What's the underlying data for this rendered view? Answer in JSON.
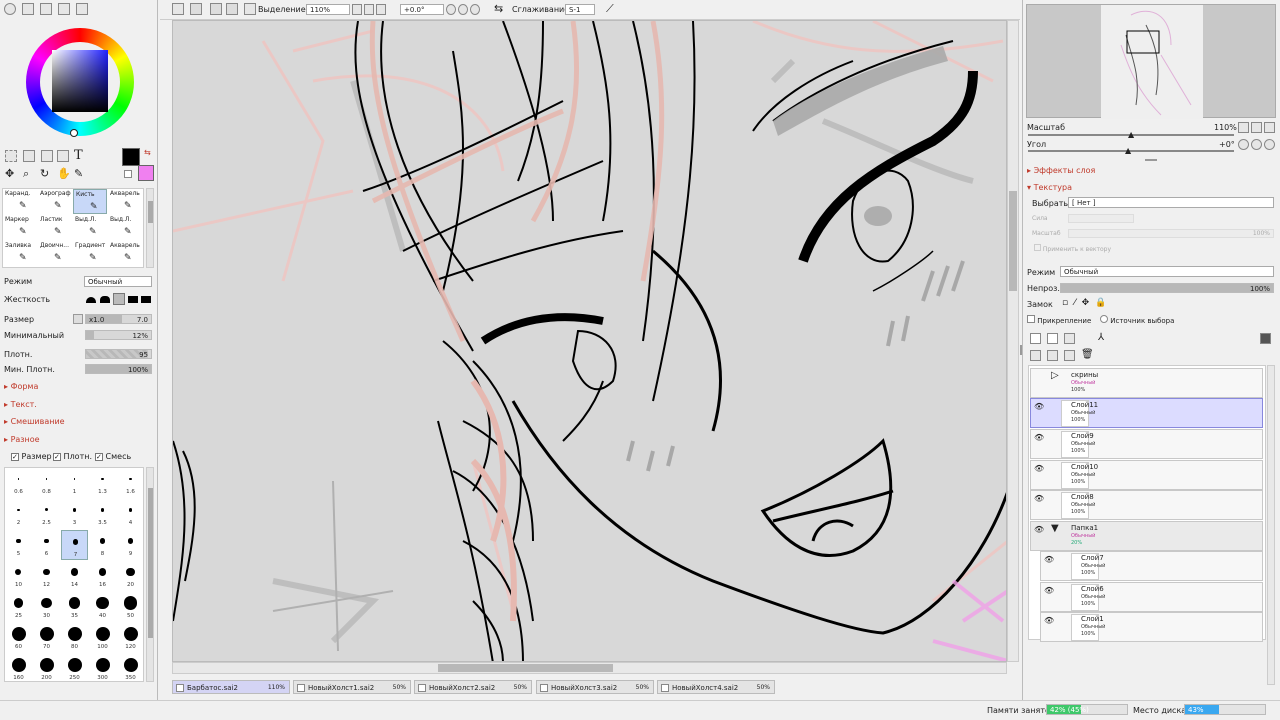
{
  "toolbar": {
    "selection_label": "Выделение",
    "zoom": "110%",
    "angle": "+0.0°",
    "smoothing_label": "Сглаживание",
    "smoothing_value": "S-1"
  },
  "tools": {
    "brush_tabs": [
      "Каранд.",
      "Аэрограф",
      "Кисть",
      "Акварель",
      "Маркер",
      "Ластик",
      "Выд.Л.",
      "Выд.Л.",
      "Заливка",
      "Двоичн...",
      "Градиент",
      "Акварель"
    ]
  },
  "brush_settings": {
    "mode_label": "Режим",
    "mode_value": "Обычный",
    "hardness_label": "Жесткость",
    "size_label": "Размер",
    "size_mult": "x1.0",
    "size_value": "7.0",
    "min_label": "Минимальный",
    "min_value": "12%",
    "density_label": "Плотн.",
    "density_value": "95",
    "min_density_label": "Мин. Плотн.",
    "min_density_value": "100%",
    "sections": [
      "Форма",
      "Текст.",
      "Смешивание",
      "Разное"
    ],
    "checks": [
      "Размер",
      "Плотн.",
      "Смесь"
    ]
  },
  "brush_sizes": {
    "rows": [
      [
        "0.6",
        "0.8",
        "1",
        "1.3",
        "1.6"
      ],
      [
        "2",
        "2.5",
        "3",
        "3.5",
        "4"
      ],
      [
        "5",
        "6",
        "7",
        "8",
        "9"
      ],
      [
        "10",
        "12",
        "14",
        "16",
        "20"
      ],
      [
        "25",
        "30",
        "35",
        "40",
        "50"
      ],
      [
        "60",
        "70",
        "80",
        "100",
        "120"
      ],
      [
        "160",
        "200",
        "250",
        "300",
        "350"
      ]
    ],
    "selected": "7"
  },
  "navigator": {
    "scale_label": "Масштаб",
    "scale_value": "110%",
    "angle_label": "Угол",
    "angle_value": "+0°"
  },
  "layer_props": {
    "effects_label": "Эффекты слоя",
    "texture_label": "Текстура",
    "choose_label": "Выбрать",
    "choose_value": "[ Нет ]",
    "strength_label": "Сила",
    "scale_label": "Масштаб",
    "scale_value": "100%",
    "apply_vector_label": "Применить к вектору",
    "mode_label": "Режим",
    "mode_value": "Обычный",
    "opacity_label": "Непроз.",
    "opacity_value": "100%",
    "lock_label": "Замок",
    "clipping_label": "Прикрепление",
    "selection_source_label": "Источник выбора"
  },
  "layers": [
    {
      "name": "скрины",
      "mode": "Обычный",
      "opacity": "100%",
      "folder": false,
      "active": false
    },
    {
      "name": "Слой11",
      "mode": "Обычный",
      "opacity": "100%",
      "folder": false,
      "active": true
    },
    {
      "name": "Слой9",
      "mode": "Обычный",
      "opacity": "100%",
      "folder": false,
      "active": false
    },
    {
      "name": "Слой10",
      "mode": "Обычный",
      "opacity": "100%",
      "folder": false,
      "active": false
    },
    {
      "name": "Слой8",
      "mode": "Обычный",
      "opacity": "100%",
      "folder": false,
      "active": false
    },
    {
      "name": "Папка1",
      "mode": "Обычный",
      "opacity": "20%",
      "folder": true,
      "active": false
    },
    {
      "name": "Слой7",
      "mode": "Обычный",
      "opacity": "100%",
      "folder": false,
      "active": false
    },
    {
      "name": "Слой6",
      "mode": "Обычный",
      "opacity": "100%",
      "folder": false,
      "active": false
    },
    {
      "name": "Слой1",
      "mode": "Обычный",
      "opacity": "100%",
      "folder": false,
      "active": false
    }
  ],
  "tabs": [
    {
      "name": "Барбатос.sai2",
      "pct": "110%"
    },
    {
      "name": "НовыйХолст1.sai2",
      "pct": "50%"
    },
    {
      "name": "НовыйХолст2.sai2",
      "pct": "50%"
    },
    {
      "name": "НовыйХолст3.sai2",
      "pct": "50%"
    },
    {
      "name": "НовыйХолст4.sai2",
      "pct": "50%"
    }
  ],
  "status": {
    "memory_label": "Памяти занято",
    "memory_value": "42% (45%)",
    "memory_fraction": 0.42,
    "disk_label": "Место диска",
    "disk_value": "43%",
    "disk_fraction": 0.43
  },
  "colors": {
    "primary": "#000000",
    "secondary": "#f080f0",
    "sketch": "#e8b8b0"
  }
}
